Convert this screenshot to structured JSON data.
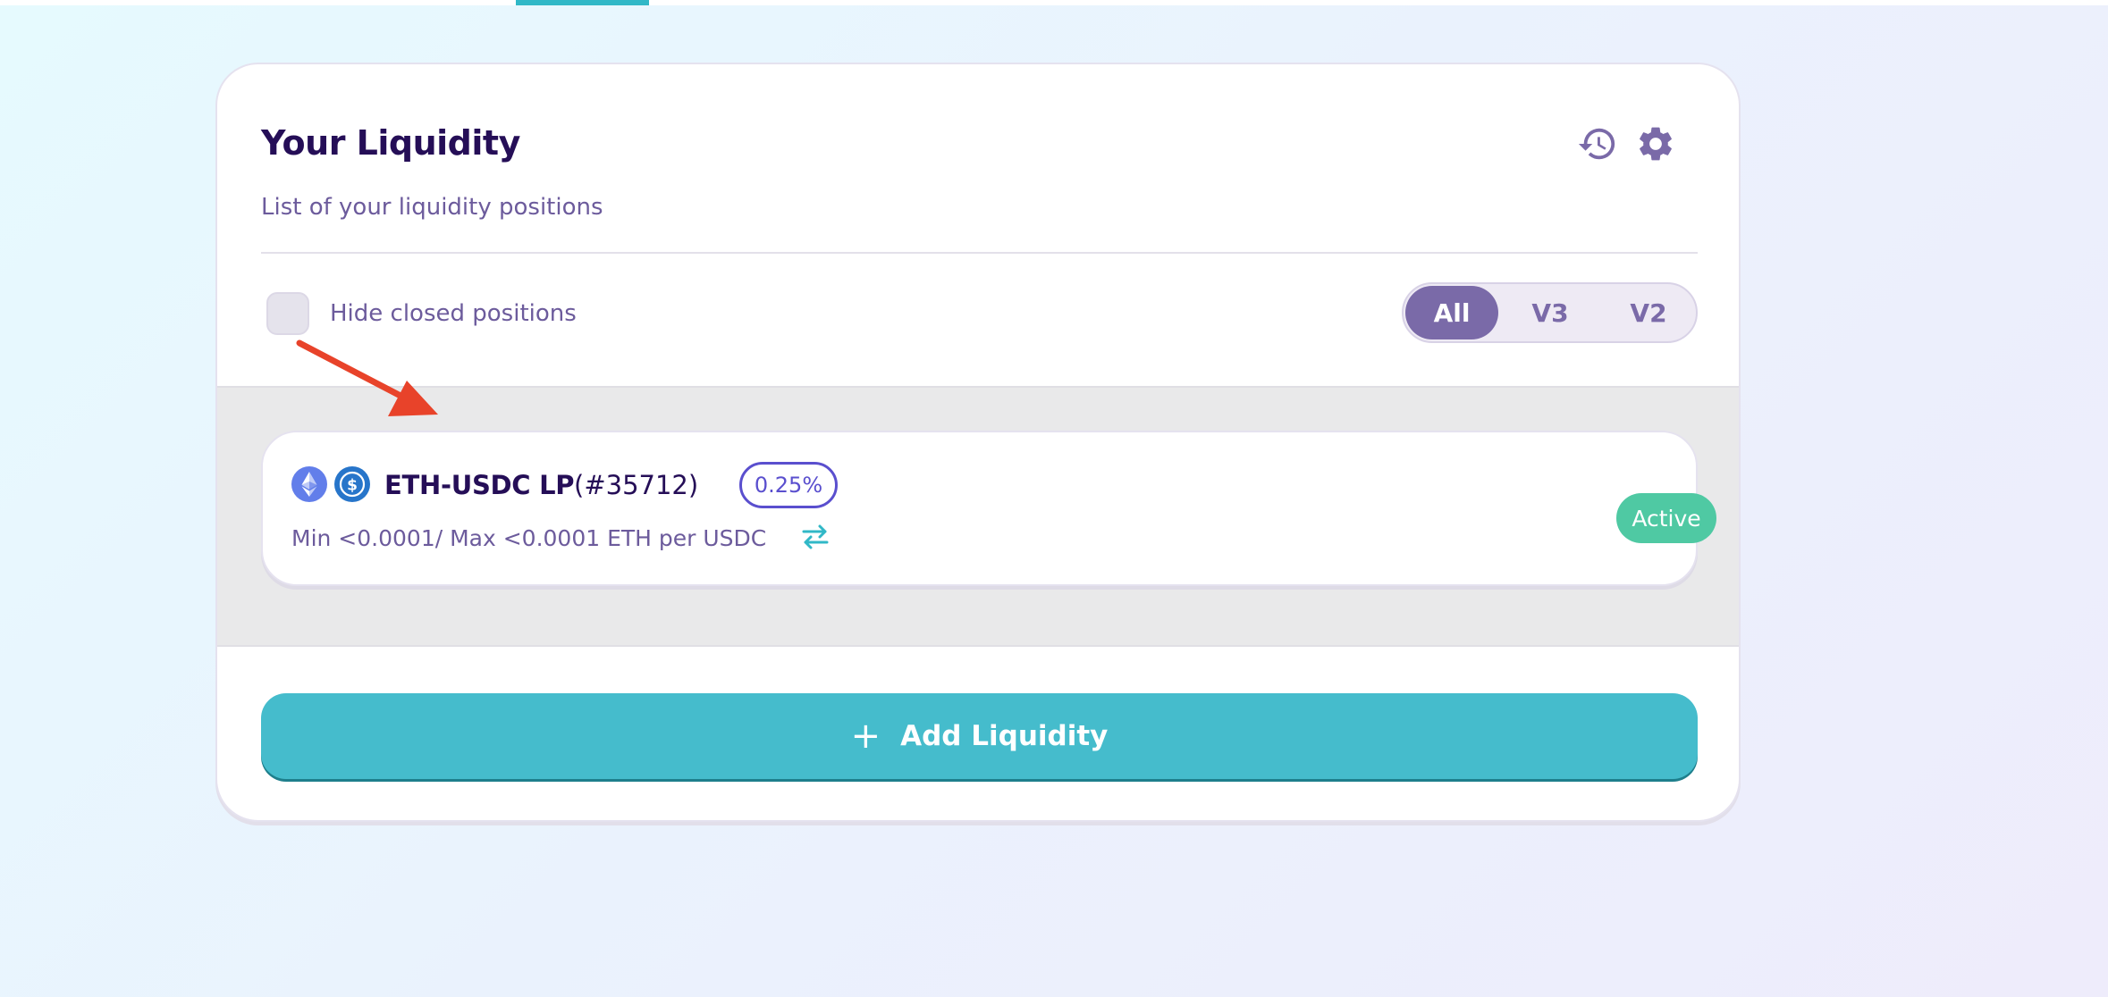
{
  "card": {
    "title": "Your Liquidity",
    "subtitle": "List of your liquidity positions"
  },
  "header_icons": [
    "history-icon",
    "settings-icon"
  ],
  "filters": {
    "hide_closed_label": "Hide closed positions",
    "hide_closed_checked": false,
    "version_tabs": [
      "All",
      "V3",
      "V2"
    ],
    "selected_version": "All"
  },
  "positions": [
    {
      "pair": "ETH-USDC LP",
      "id": "(#35712)",
      "fee": "0.25%",
      "range": "Min <0.0001/ Max <0.0001 ETH per USDC",
      "status": "Active",
      "tokens": [
        "eth-token-icon",
        "usdc-token-icon"
      ]
    }
  ],
  "actions": {
    "add_liquidity_label": "Add Liquidity",
    "add_liquidity_icon": "+"
  },
  "colors": {
    "accent": "#45bccc",
    "primary_text": "#250e57",
    "secondary_text": "#6c5b9c",
    "segment_active": "#7a6aa8",
    "status_active": "#4fc9a3",
    "fee_badge": "#5a4fce",
    "annotation_arrow": "#e8432a"
  }
}
